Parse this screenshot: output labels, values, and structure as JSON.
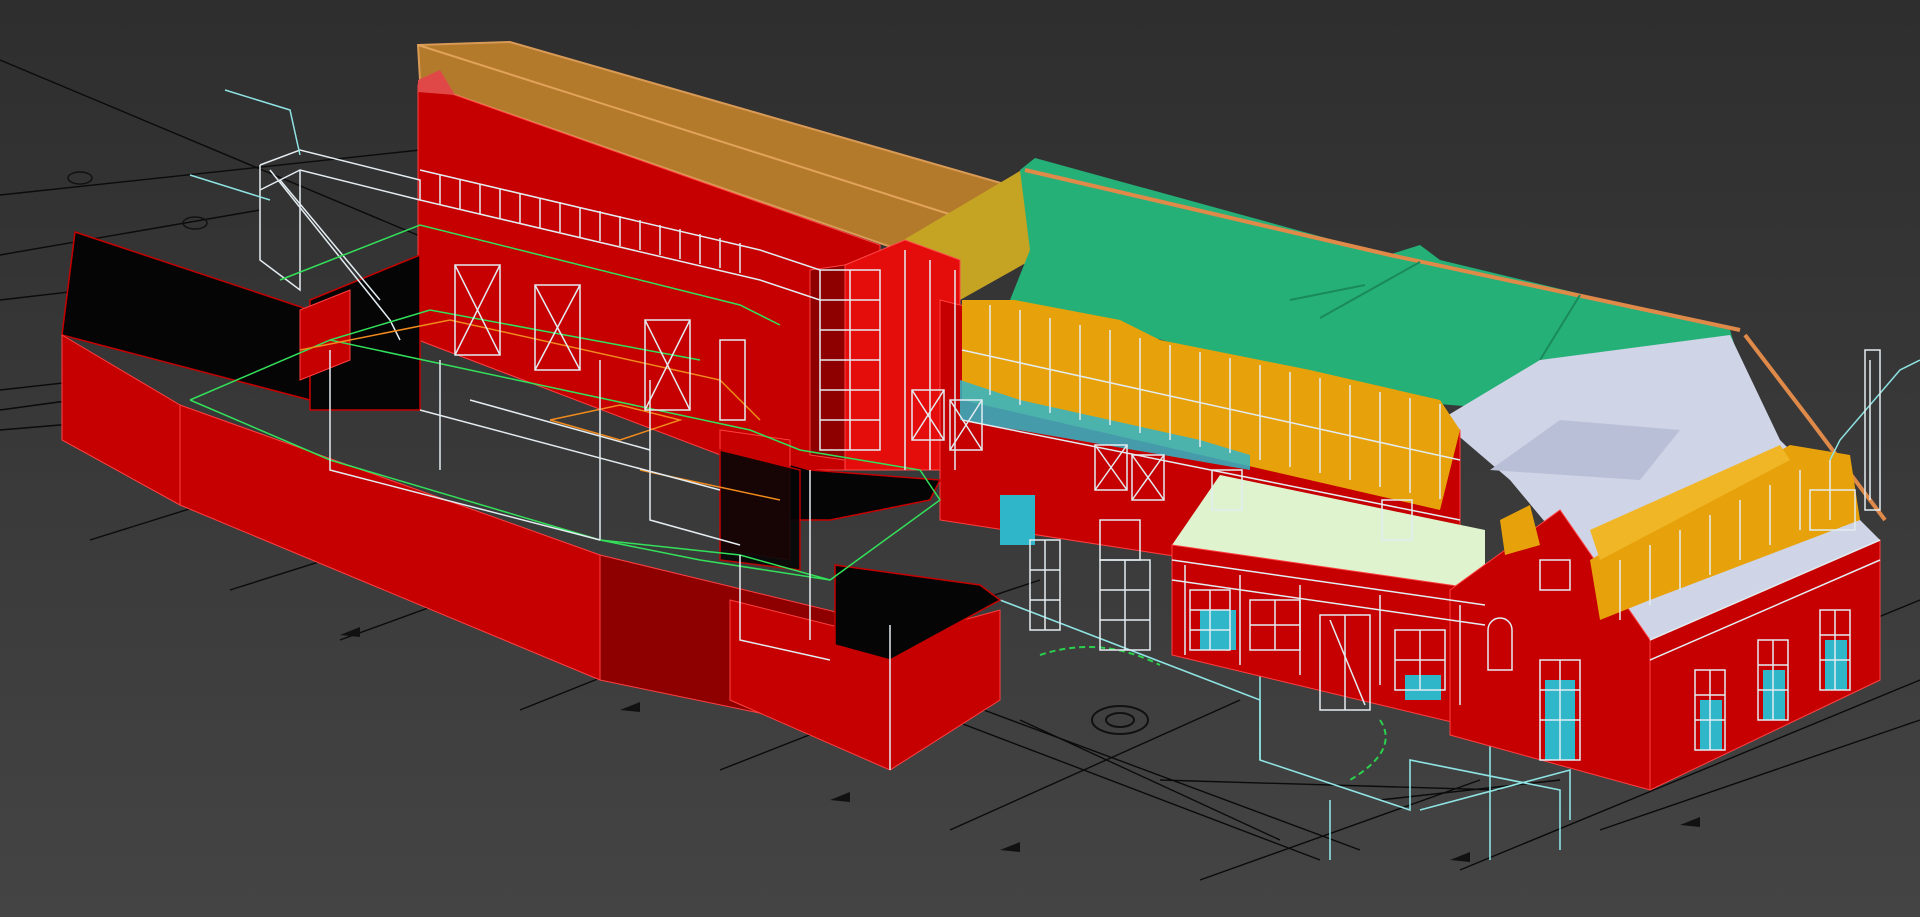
{
  "viewport": {
    "background": "#3b3b3b",
    "grid_color": "#0d0d0d",
    "wire_color": "#dfe9ef",
    "wire_cyan": "#8fe3e3",
    "wire_green": "#33e05a",
    "wire_orange": "#f08a1c"
  },
  "materials": {
    "wall": "#c60000",
    "wall_dark": "#8e0000",
    "wall_light": "#e50c0c",
    "roof_orange": "#b47a2c",
    "roof_green": "#25b078",
    "roof_green_dark": "#1e9965",
    "roof_white": "#cfd4e6",
    "roof_pale": "#dff3cf",
    "roof_olive": "#c5a424",
    "dormer_amber": "#e7a20b",
    "glass_cyan": "#2fb6c9",
    "black": "#050505",
    "trim": "#e08a4a"
  }
}
